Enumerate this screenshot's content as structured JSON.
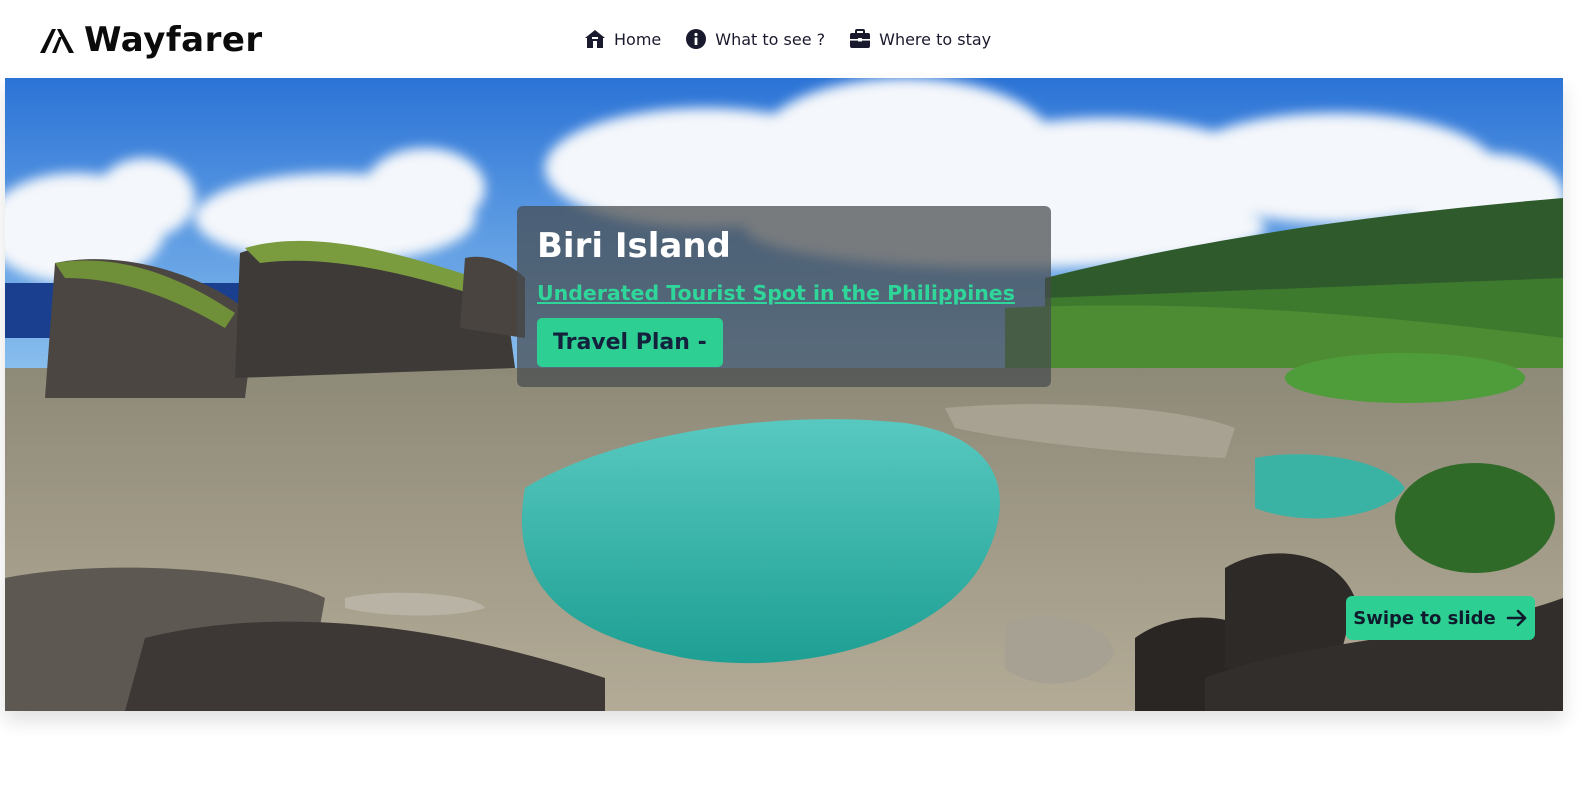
{
  "brand": {
    "name": "Wayfarer",
    "icon": "logo-mountain-icon"
  },
  "nav": {
    "items": [
      {
        "label": "Home",
        "icon": "home-icon"
      },
      {
        "label": "What to see ?",
        "icon": "info-icon"
      },
      {
        "label": "Where to stay",
        "icon": "briefcase-icon"
      }
    ]
  },
  "hero": {
    "title": "Biri Island",
    "subtitle_link": "Underated Tourist Spot in the Philippines",
    "plan_button": "Travel Plan -",
    "swipe_button": "Swipe to slide",
    "swipe_icon": "arrow-right-icon"
  },
  "colors": {
    "accent": "#2ecf93",
    "link": "#2fd69a",
    "text_dark": "#14213d",
    "card_bg": "rgba(70,75,78,0.72)"
  }
}
